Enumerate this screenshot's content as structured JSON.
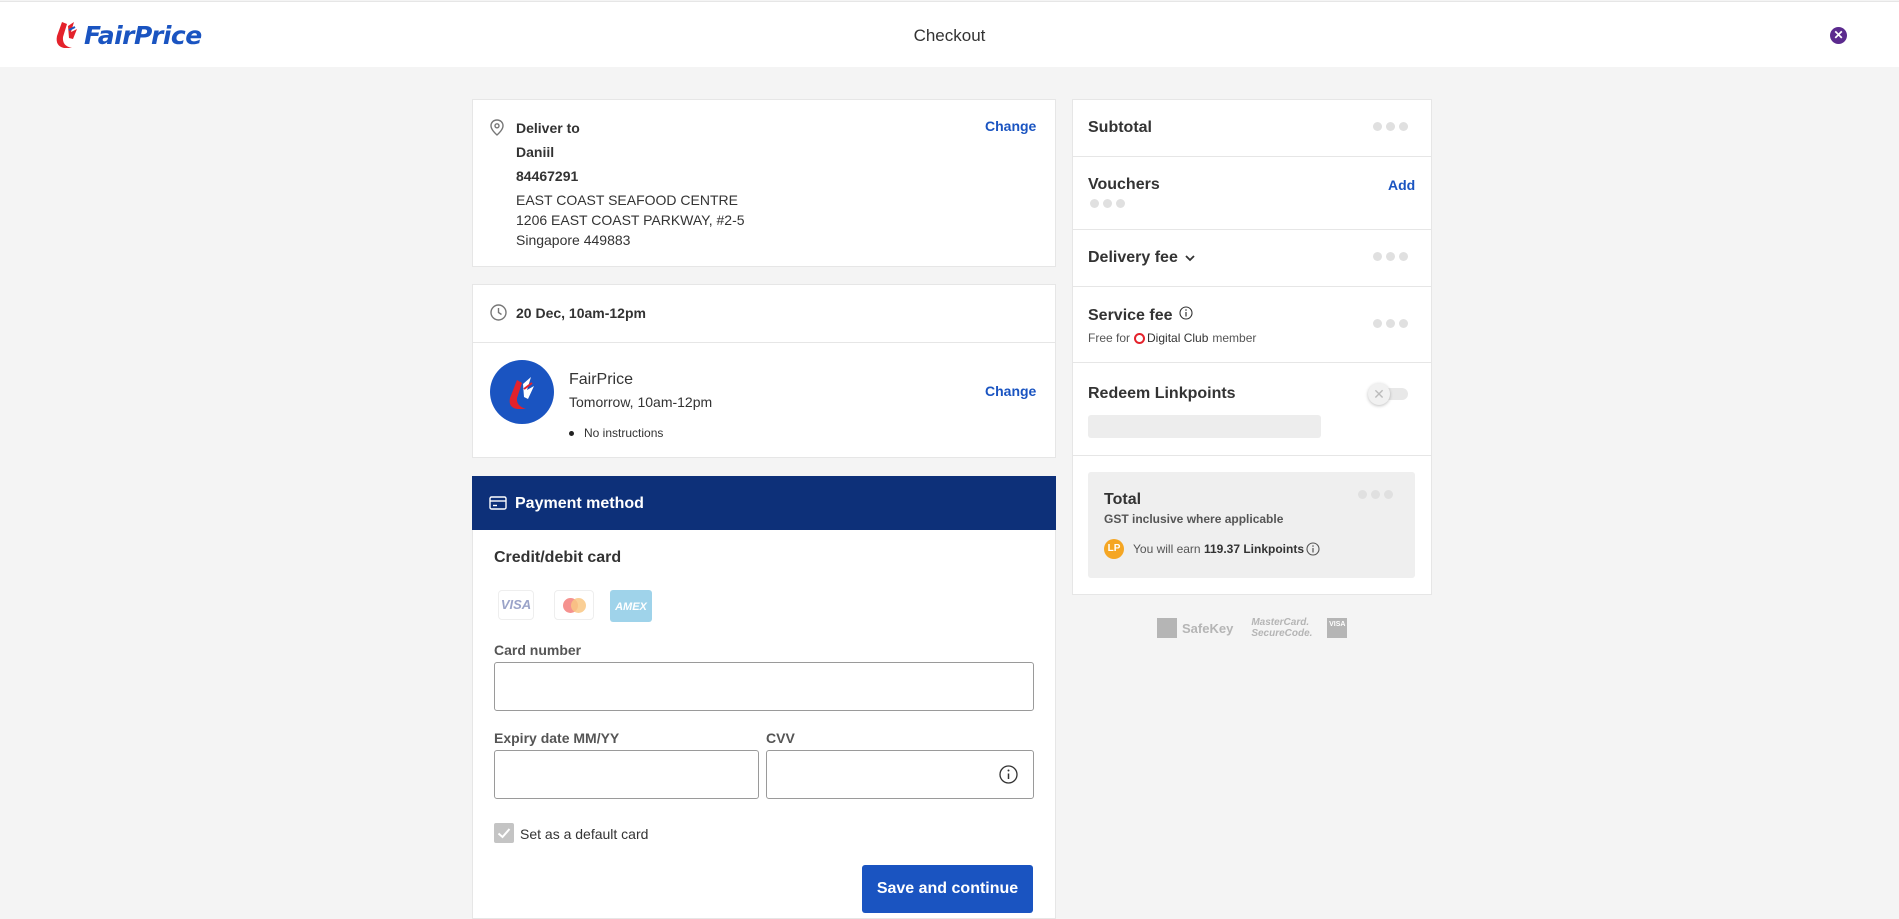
{
  "header": {
    "logo_text": "FairPrice",
    "title": "Checkout",
    "close_icon": "close-icon"
  },
  "delivery": {
    "heading": "Deliver to",
    "change_label": "Change",
    "name": "Daniil",
    "phone": "84467291",
    "address_line1": "EAST COAST SEAFOOD CENTRE",
    "address_line2": "1206 EAST COAST PARKWAY, #2-5",
    "address_line3": "Singapore 449883"
  },
  "slot": {
    "date": "20 Dec, 10am-12pm",
    "store_name": "FairPrice",
    "store_time": "Tomorrow, 10am-12pm",
    "instructions": "No instructions",
    "change_label": "Change"
  },
  "payment": {
    "bar_title": "Payment method",
    "section_title": "Credit/debit card",
    "card_brands": [
      "VISA",
      "mastercard",
      "AMEX"
    ],
    "card_number_label": "Card number",
    "card_number_value": "",
    "expiry_label": "Expiry date MM/YY",
    "expiry_value": "",
    "cvv_label": "CVV",
    "cvv_value": "",
    "default_card_label": "Set as a default card",
    "default_card_checked": true,
    "save_label": "Save and continue"
  },
  "summary": {
    "subtotal_label": "Subtotal",
    "vouchers_label": "Vouchers",
    "vouchers_add": "Add",
    "delivery_fee_label": "Delivery fee",
    "service_fee_label": "Service fee",
    "service_fee_note_prefix": "Free for",
    "service_fee_note_brand": "Digital Club",
    "service_fee_note_suffix": "member",
    "redeem_label": "Redeem Linkpoints",
    "redeem_toggle_on": false,
    "total_label": "Total",
    "gst_note": "GST inclusive where applicable",
    "lp_badge": "LP",
    "earn_prefix": "You will earn",
    "earn_points": "119.37 Linkpoints"
  },
  "security_logos": [
    "SafeKey",
    "MasterCard. SecureCode.",
    "VISA"
  ],
  "colors": {
    "brand_blue": "#1a54c1",
    "payment_bar": "#0d3079",
    "fairprice_red": "#e4222b",
    "lp_orange": "#f5a623",
    "close_purple": "#5b2a8e"
  }
}
